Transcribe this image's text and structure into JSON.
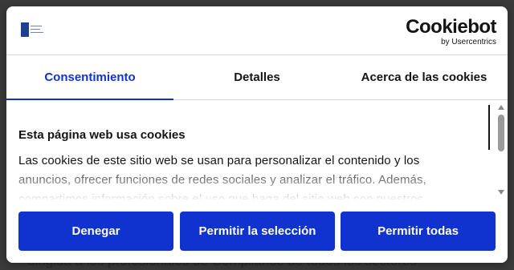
{
  "background": {
    "text": "dirigida a los profesionales de Compliance de todos los sectores"
  },
  "header": {
    "brand_word": "Cookiebot",
    "brand_sub": "by Usercentrics"
  },
  "tabs": [
    {
      "label": "Consentimiento",
      "active": true
    },
    {
      "label": "Detalles",
      "active": false
    },
    {
      "label": "Acerca de las cookies",
      "active": false
    }
  ],
  "content": {
    "heading": "Esta página web usa cookies",
    "text": "Las cookies de este sitio web se usan para personalizar el contenido y los anuncios, ofrecer funciones de redes sociales y analizar el tráfico. Además, compartimos información sobre el uso que haga del sitio web con nuestros partners"
  },
  "buttons": {
    "deny": "Denegar",
    "allow_selection": "Permitir la selección",
    "allow_all": "Permitir todas"
  },
  "colors": {
    "accent": "#1032cf",
    "text": "#141414",
    "overlay": "#3a3a3a"
  }
}
